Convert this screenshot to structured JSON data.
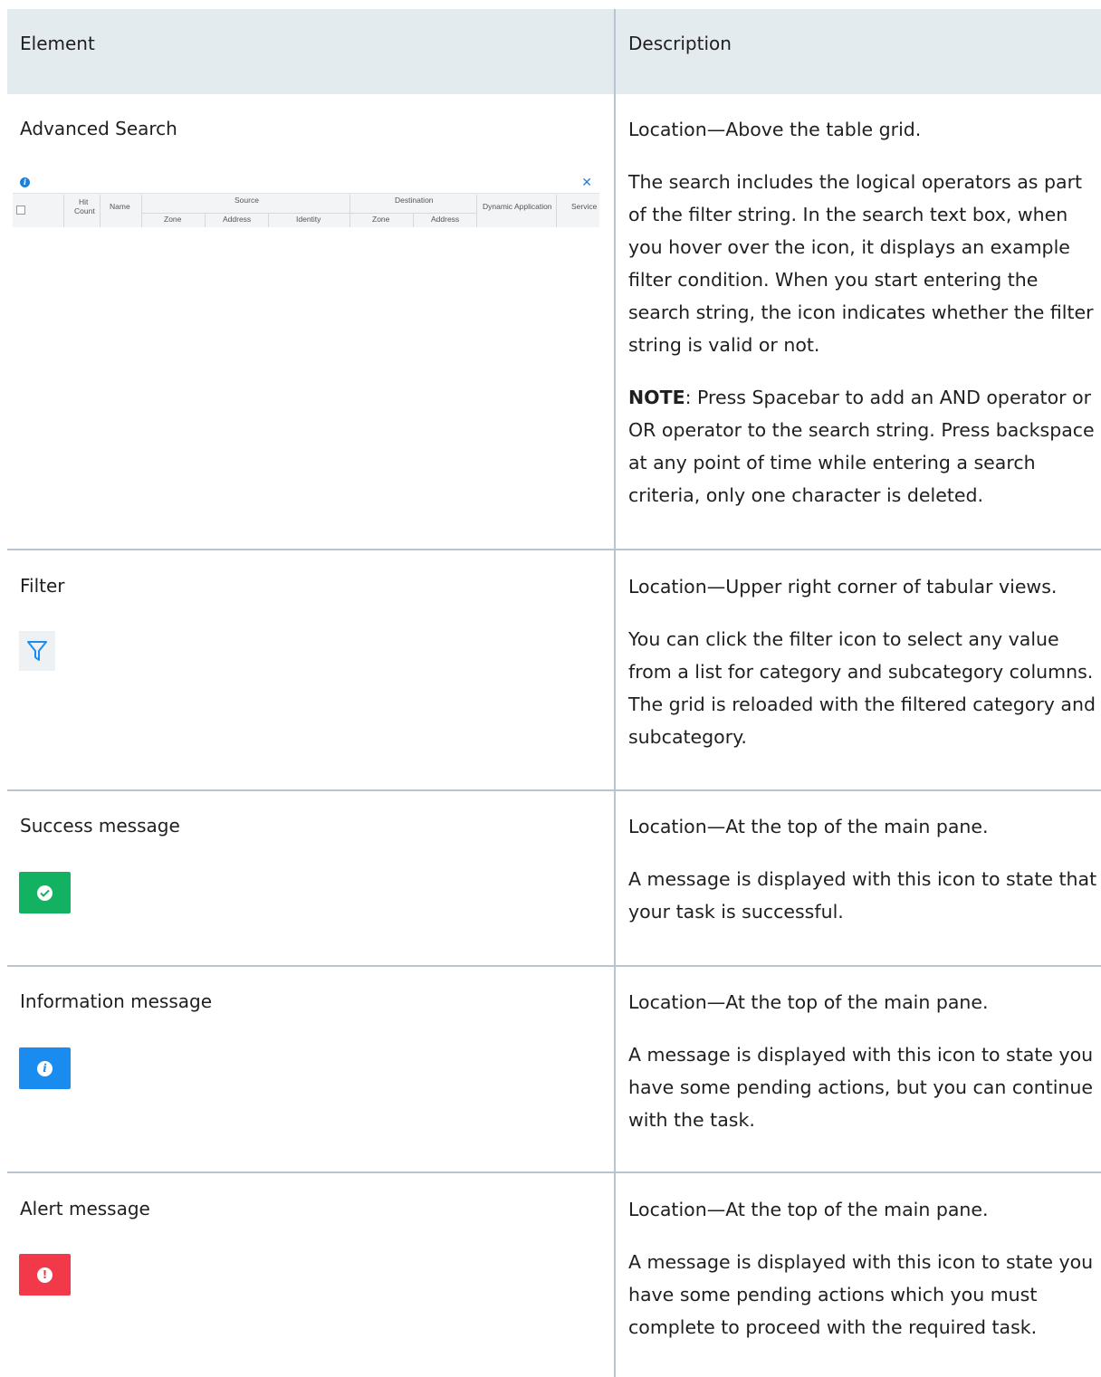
{
  "header": {
    "element": "Element",
    "description": "Description"
  },
  "rows": [
    {
      "element": "Advanced Search",
      "desc": [
        "Location—Above the table grid.",
        "The search includes the logical operators as part of the filter string. In the search text box, when you hover over the icon, it displays an example filter condition. When you start entering the search string, the icon indicates whether the filter string is valid or not."
      ],
      "note_label": "NOTE",
      "note_text": ": Press Spacebar to add an AND operator or OR operator to the search string. Press backspace at any point of time while entering a search criteria, only one character is deleted.",
      "grid": {
        "hit": "Hit",
        "count": "Count",
        "name": "Name",
        "source": "Source",
        "destination": "Destination",
        "zone": "Zone",
        "address": "Address",
        "identity": "Identity",
        "dynamic_app": "Dynamic Application",
        "service": "Service"
      }
    },
    {
      "element": "Filter",
      "desc": [
        "Location—Upper right corner of tabular views.",
        "You can click the filter icon to select any value from a list for category and subcategory columns. The grid is reloaded with the filtered category and subcategory."
      ]
    },
    {
      "element": "Success message",
      "desc": [
        "Location—At the top of the main pane.",
        "A message is displayed with this icon to state that your task is successful."
      ]
    },
    {
      "element": "Information message",
      "desc": [
        "Location—At the top of the main pane.",
        "A message is displayed with this icon to state you have some pending actions, but you can continue with the task."
      ]
    },
    {
      "element": "Alert message",
      "desc": [
        "Location—At the top of the main pane.",
        "A message is displayed with this icon to state you have some pending actions which you must complete to proceed with the required task."
      ]
    }
  ],
  "colors": {
    "success": "#13b263",
    "info": "#1a8cf0",
    "alert": "#f2394a",
    "border": "#b8c4cf",
    "header_bg": "#e4ebef"
  },
  "icons": {
    "filter": "filter-icon",
    "success": "check-circle-icon",
    "info": "info-icon",
    "alert": "exclamation-icon",
    "close": "close-icon"
  }
}
